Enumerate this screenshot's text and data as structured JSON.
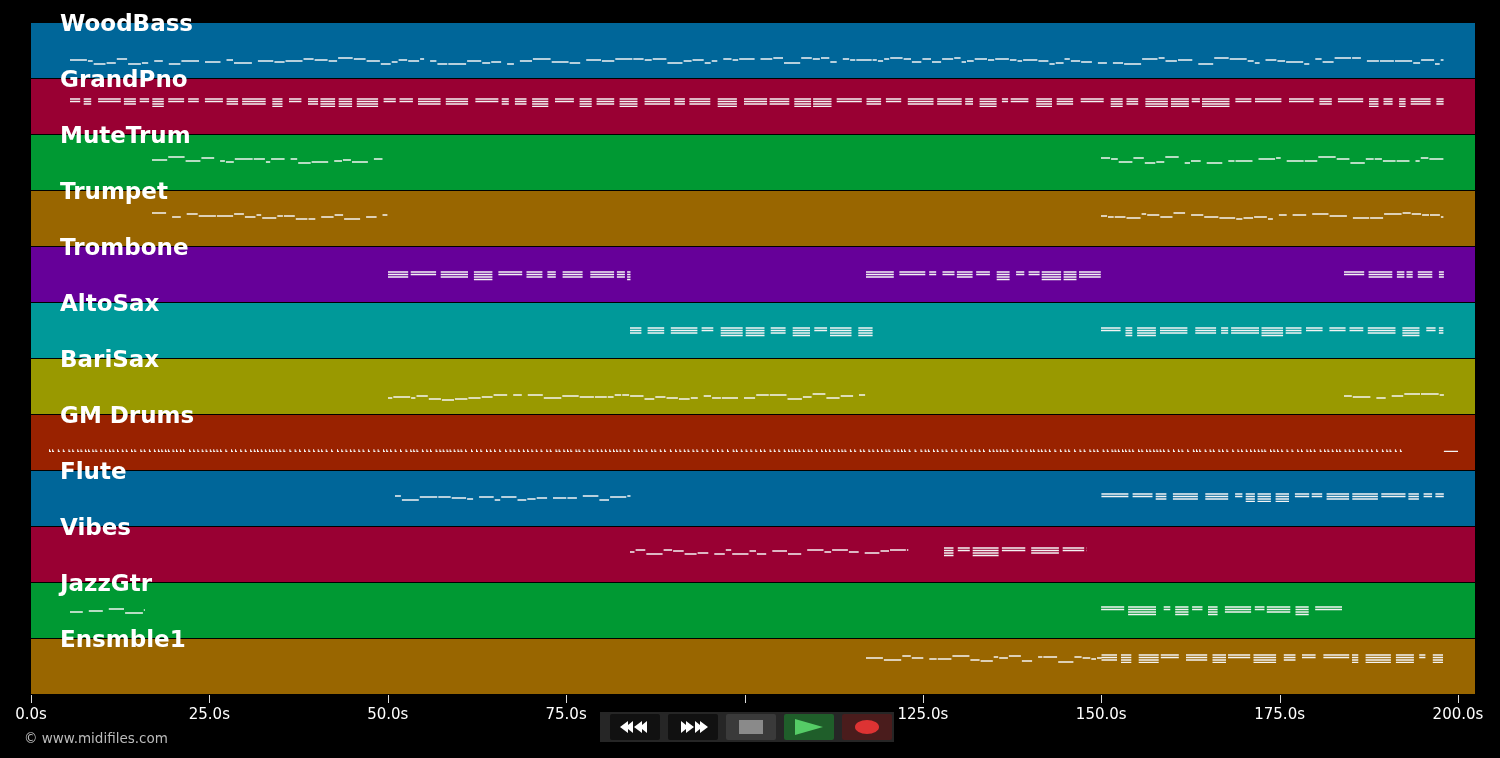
{
  "tracks": [
    {
      "name": "WoodBass",
      "color": "#006699"
    },
    {
      "name": "GrandPno",
      "color": "#990033"
    },
    {
      "name": "MuteTrum",
      "color": "#009933"
    },
    {
      "name": "Trumpet",
      "color": "#996600"
    },
    {
      "name": "Trombone",
      "color": "#660099"
    },
    {
      "name": "AltoSax",
      "color": "#009999"
    },
    {
      "name": "BariSax",
      "color": "#999900"
    },
    {
      "name": "GM Drums",
      "color": "#992200"
    },
    {
      "name": "Flute",
      "color": "#006699"
    },
    {
      "name": "Vibes",
      "color": "#990033"
    },
    {
      "name": "JazzGtr",
      "color": "#009933"
    },
    {
      "name": "Ensmble1",
      "color": "#996600"
    }
  ],
  "time_axis": {
    "labels": [
      "0.0s",
      "25.0s",
      "50.0s",
      "75.0s",
      "125.0s",
      "150.0s",
      "175.0s",
      "200.0s"
    ]
  },
  "credit": "© www.midifiles.com"
}
